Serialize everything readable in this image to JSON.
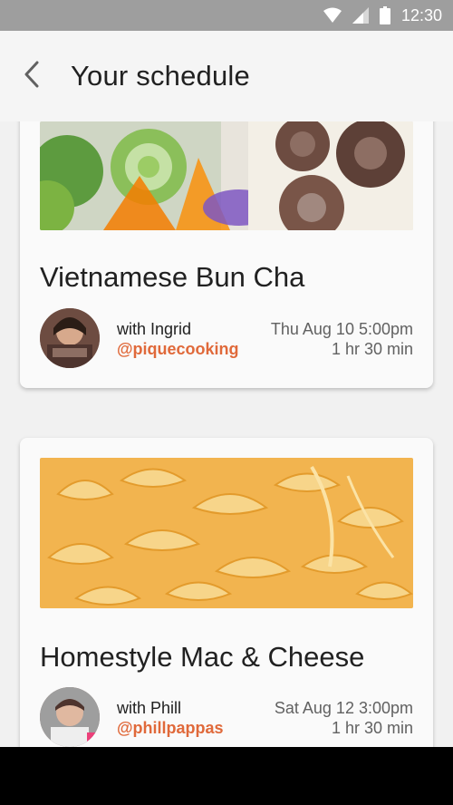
{
  "status_bar": {
    "time": "12:30",
    "icons": [
      "wifi-icon",
      "signal-icon",
      "battery-icon"
    ]
  },
  "header": {
    "title": "Your schedule",
    "back_icon": "back-arrow-icon"
  },
  "classes": [
    {
      "title": "Vietnamese Bun Cha",
      "host_label": "with Ingrid",
      "handle": "@piquecooking",
      "date_time": "Thu Aug 10 5:00pm",
      "duration": "1 hr 30 min"
    },
    {
      "title": "Homestyle Mac & Cheese",
      "host_label": "with Phill",
      "handle": "@phillpappas",
      "date_time": "Sat Aug 12 3:00pm",
      "duration": "1 hr 30 min"
    }
  ],
  "colors": {
    "accent": "#e0693a",
    "status_bar": "#9e9e9e",
    "app_bar": "#f5f5f5",
    "background": "#f1f1f1",
    "nav_bar": "#000000"
  }
}
